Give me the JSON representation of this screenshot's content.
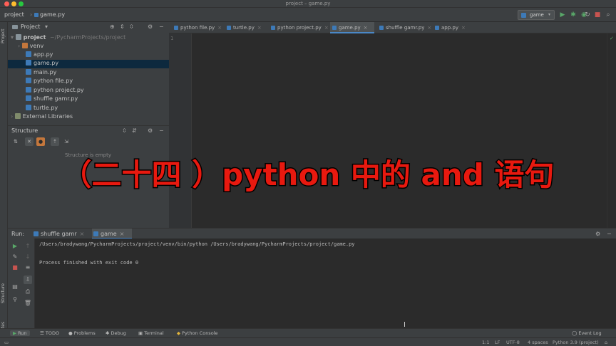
{
  "window": {
    "title": "project – game.py"
  },
  "colors": {
    "run_green": "#59a869",
    "accent_blue": "#4a88c7",
    "overlay_red": "#e8190f",
    "stop_red": "#c75450"
  },
  "navbar": {
    "breadcrumb_project": "project",
    "breadcrumb_file": "game.py",
    "run_config": "game"
  },
  "sidebar_strip": {
    "project": "Project",
    "structure": "Structure",
    "favorites": "Favorites"
  },
  "project_panel": {
    "title": "Project",
    "root_name": "project",
    "root_path": "~/PycharmProjects/project",
    "items": [
      {
        "label": "venv",
        "kind": "folder"
      },
      {
        "label": "app.py",
        "kind": "py"
      },
      {
        "label": "game.py",
        "kind": "py",
        "selected": true
      },
      {
        "label": "main.py",
        "kind": "py"
      },
      {
        "label": "python file.py",
        "kind": "py"
      },
      {
        "label": "python project.py",
        "kind": "py"
      },
      {
        "label": "shuffle gamr.py",
        "kind": "py"
      },
      {
        "label": "turtle.py",
        "kind": "py"
      }
    ],
    "external": "External Libraries"
  },
  "structure_panel": {
    "title": "Structure",
    "empty_text": "Structure is empty"
  },
  "editor": {
    "tabs": [
      "python file.py",
      "turtle.py",
      "python project.py",
      "game.py",
      "shuffle gamr.py",
      "app.py"
    ],
    "active_tab": "game.py",
    "line_number": "1"
  },
  "overlay": {
    "caption": "（二十四 ）python 中的 and 语句"
  },
  "run_panel": {
    "label": "Run:",
    "tabs": [
      "shuffle gamr",
      "game"
    ],
    "console": [
      "/Users/bradywang/PycharmProjects/project/venv/bin/python /Users/bradywang/PycharmProjects/project/game.py",
      "",
      "Process finished with exit code 0"
    ]
  },
  "bottom_tools": [
    "Run",
    "TODO",
    "Problems",
    "Debug",
    "Terminal",
    "Python Console"
  ],
  "status_bar": {
    "position": "1:1",
    "line_sep": "LF",
    "encoding": "UTF-8",
    "indent": "4 spaces",
    "interpreter": "Python 3.9 (project)",
    "event_log": "Event Log"
  }
}
